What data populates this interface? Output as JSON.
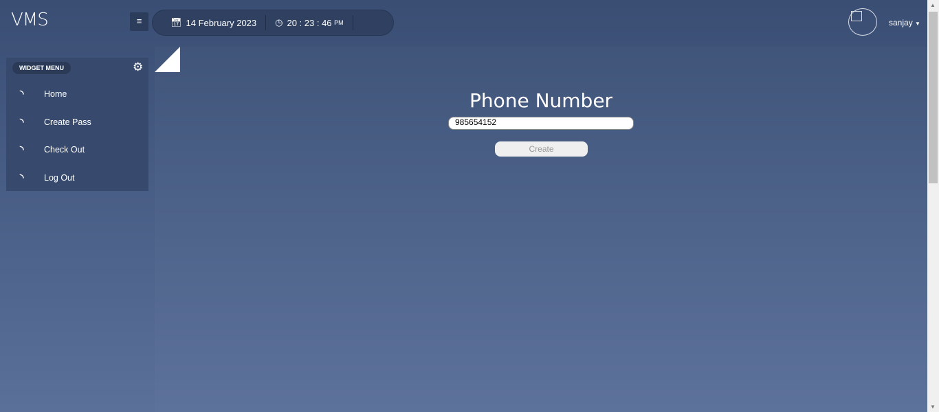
{
  "app": {
    "title": "VMS"
  },
  "header": {
    "date": "14 February 2023",
    "time": "20 : 23 : 46",
    "ampm": "PM",
    "user": "sanjay"
  },
  "sidebar": {
    "title": "WIDGET MENU",
    "items": [
      {
        "label": "Home"
      },
      {
        "label": "Create Pass"
      },
      {
        "label": "Check Out"
      },
      {
        "label": "Log Out"
      }
    ]
  },
  "main": {
    "heading": "Phone Number",
    "phone_value": "985654152",
    "create_label": "Create"
  }
}
